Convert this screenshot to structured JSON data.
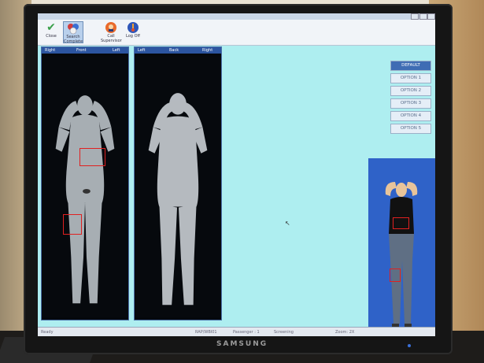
{
  "window": {
    "title": ""
  },
  "toolbar": {
    "items": [
      {
        "label": "Close",
        "icon": "check-icon"
      },
      {
        "label": "Search Complete",
        "icon": "search-complete-icon"
      },
      {
        "label": "Call Supervisor",
        "icon": "call-supervisor-icon"
      },
      {
        "label": "Log Off",
        "icon": "log-off-icon"
      }
    ]
  },
  "front_panel": {
    "left_label": "Right",
    "center_label": "Front",
    "right_label": "Left"
  },
  "back_panel": {
    "left_label": "Left",
    "center_label": "Back",
    "right_label": "Right"
  },
  "options": [
    "DEFAULT",
    "OPTION 1",
    "OPTION 2",
    "OPTION 3",
    "OPTION 4",
    "OPTION 5"
  ],
  "selected_option": "DEFAULT",
  "status": {
    "left": "Ready",
    "station": "RAP/WBI01",
    "passenger": "Passenger : 1",
    "mode": "Screening",
    "zoom": "Zoom: 2X"
  },
  "monitor_brand": "SAMSUNG",
  "colors": {
    "screen_bg": "#aeeef0",
    "panel_header": "#2c55a0",
    "detection": "#e02020",
    "avatar_bg": "#2f62c8",
    "option_selected": "#3f6db4"
  }
}
